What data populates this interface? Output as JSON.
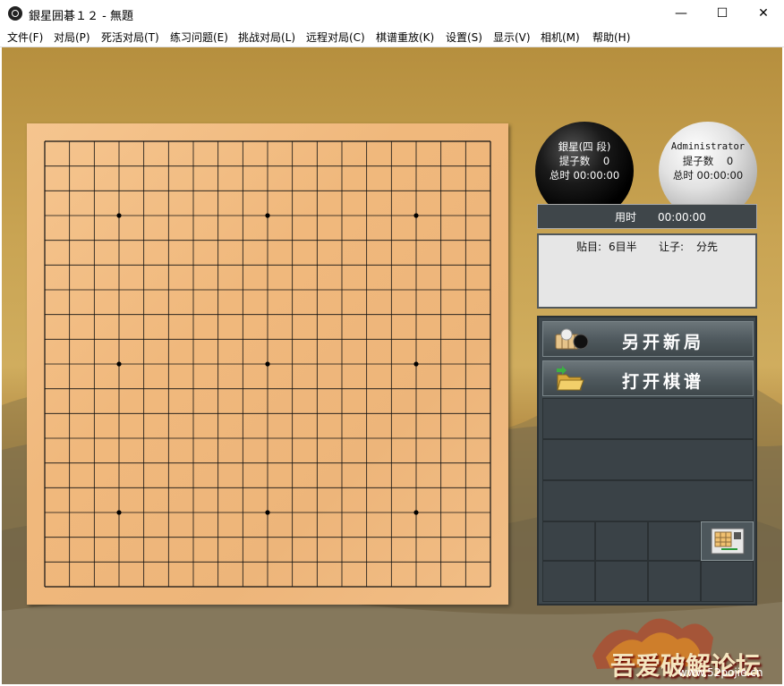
{
  "window": {
    "title": "銀星囲碁１２ - 無題",
    "controls": {
      "minimize": "—",
      "maximize": "☐",
      "close": "✕"
    }
  },
  "menu": {
    "items": [
      "文件(F)",
      "对局(P)",
      "死活对局(T)",
      "练习问题(E)",
      "挑战对局(L)",
      "远程对局(C)",
      "棋谱重放(K)",
      "设置(S)",
      "显示(V)",
      "相机(M)",
      "帮助(H)"
    ]
  },
  "board": {
    "size": 19,
    "star_points": [
      [
        3,
        3
      ],
      [
        9,
        3
      ],
      [
        15,
        3
      ],
      [
        3,
        9
      ],
      [
        9,
        9
      ],
      [
        15,
        9
      ],
      [
        3,
        15
      ],
      [
        9,
        15
      ],
      [
        15,
        15
      ]
    ]
  },
  "players": {
    "black": {
      "name": "銀星(四 段)",
      "captures_label": "提子数",
      "captures": "0",
      "time_label": "总时",
      "time": "00:00:00"
    },
    "white": {
      "name": "Administrator",
      "captures_label": "提子数",
      "captures": "0",
      "time_label": "总时",
      "time": "00:00:00"
    }
  },
  "move_time": {
    "label": "用时",
    "value": "00:00:00"
  },
  "game_info": {
    "komi_label": "贴目:",
    "komi": "6目半",
    "handicap_label": "让子:",
    "handicap": "分先"
  },
  "buttons": {
    "new_game": "另开新局",
    "open_record": "打开棋谱"
  },
  "watermark": {
    "logo_text": "吾爱破解论坛",
    "site_text": "www.52pojie.cn"
  },
  "colors": {
    "panel": "#3e474c",
    "board": "#f0b87c",
    "background": "#c9a453"
  }
}
